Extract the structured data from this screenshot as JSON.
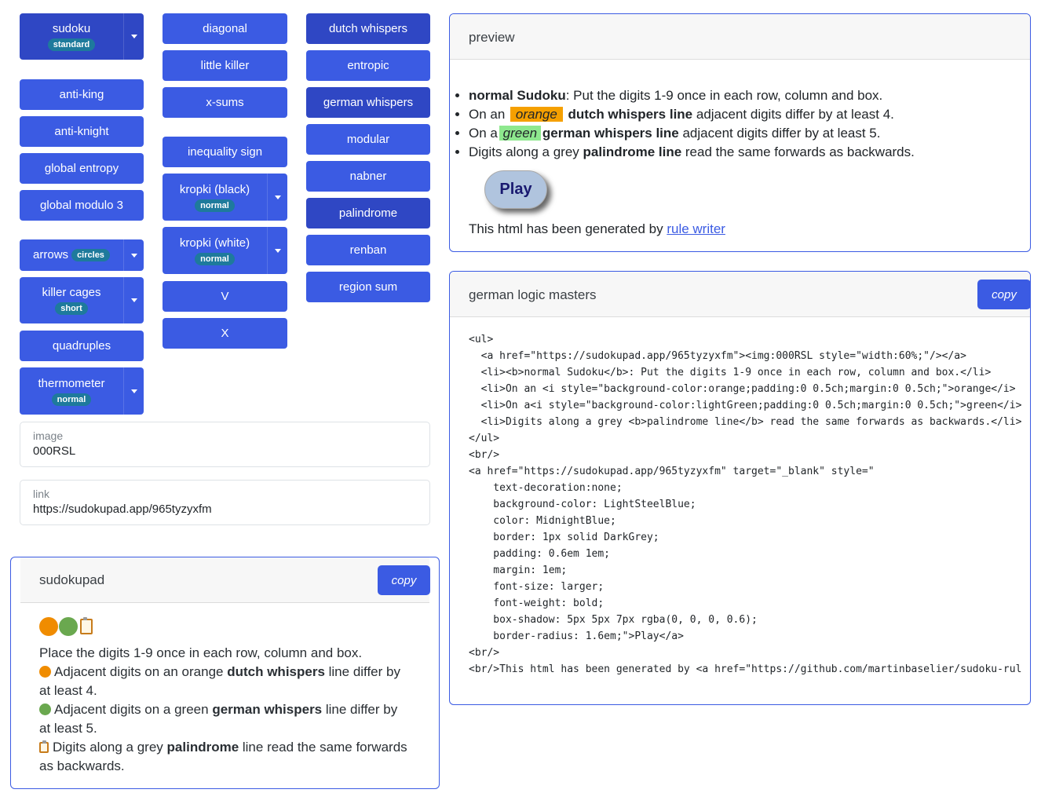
{
  "col1": {
    "sudoku": {
      "label": "sudoku",
      "badge": "standard"
    },
    "anti_king": "anti-king",
    "anti_knight": "anti-knight",
    "global_entropy": "global entropy",
    "global_modulo": "global modulo 3",
    "arrows": {
      "label": "arrows",
      "badge": "circles"
    },
    "killer_cages": {
      "label": "killer cages",
      "badge": "short"
    },
    "quadruples": "quadruples",
    "thermometer": {
      "label": "thermometer",
      "badge": "normal"
    }
  },
  "col2": {
    "diagonal": "diagonal",
    "little_killer": "little killer",
    "x_sums": "x-sums",
    "inequality_sign": "inequality sign",
    "kropki_black": {
      "label": "kropki (black)",
      "badge": "normal"
    },
    "kropki_white": {
      "label": "kropki (white)",
      "badge": "normal"
    },
    "v": "V",
    "x": "X"
  },
  "col3": {
    "dutch_whispers": "dutch whispers",
    "entropic": "entropic",
    "german_whispers": "german whispers",
    "modular": "modular",
    "nabner": "nabner",
    "palindrome": "palindrome",
    "renban": "renban",
    "region_sum": "region sum"
  },
  "fields": {
    "image": {
      "label": "image",
      "value": "000RSL"
    },
    "link": {
      "label": "link",
      "value": "https://sudokupad.app/965tyzyxfm"
    }
  },
  "preview": {
    "title": "preview",
    "rule1_bold": "normal Sudoku",
    "rule1_rest": ": Put the digits 1-9 once in each row, column and box.",
    "rule2_pre": "On an",
    "rule2_hl": "orange",
    "rule2_bold": "dutch whispers line",
    "rule2_rest": " adjacent digits differ by at least 4.",
    "rule3_pre": "On a",
    "rule3_hl": "green",
    "rule3_bold": "german whispers line",
    "rule3_rest": " adjacent digits differ by at least 5.",
    "rule4_pre": "Digits along a grey ",
    "rule4_bold": "palindrome line",
    "rule4_rest": " read the same forwards as backwards.",
    "play": "Play",
    "generated_pre": "This html has been generated by ",
    "generated_link": "rule writer"
  },
  "glm": {
    "title": "german logic masters",
    "copy": "copy",
    "code_lines": [
      "<ul>",
      "  <a href=\"https://sudokupad.app/965tyzyxfm\"><img:000RSL style=\"width:60%;\"/></a>",
      "  <li><b>normal Sudoku</b>: Put the digits 1-9 once in each row, column and box.</li>",
      "  <li>On an <i style=\"background-color:orange;padding:0 0.5ch;margin:0 0.5ch;\">orange</i>",
      "  <li>On a<i style=\"background-color:lightGreen;padding:0 0.5ch;margin:0 0.5ch;\">green</i>",
      "  <li>Digits along a grey <b>palindrome line</b> read the same forwards as backwards.</li>",
      "</ul>",
      "<br/>",
      "<a href=\"https://sudokupad.app/965tyzyxfm\" target=\"_blank\" style=\"",
      "    text-decoration:none;",
      "    background-color: LightSteelBlue;",
      "    color: MidnightBlue;",
      "    border: 1px solid DarkGrey;",
      "    padding: 0.6em 1em;",
      "    margin: 1em;",
      "    font-size: larger;",
      "    font-weight: bold;",
      "    box-shadow: 5px 5px 7px rgba(0, 0, 0, 0.6);",
      "    border-radius: 1.6em;\">Play</a>",
      "<br/>",
      "<br/>This html has been generated by <a href=\"https://github.com/martinbaselier/sudoku-rul"
    ]
  },
  "sudokupad": {
    "title": "sudokupad",
    "copy": "copy",
    "line1": "Place the digits 1-9 once in each row, column and box.",
    "line2_pre": "Adjacent digits on an orange ",
    "line2_bold": "dutch whispers",
    "line2_rest": " line differ by at least 4.",
    "line3_pre": "Adjacent digits on a green ",
    "line3_bold": "german whispers",
    "line3_rest": " line differ by at least 5.",
    "line4_pre": "Digits along a grey ",
    "line4_bold": "palindrome",
    "line4_rest": " line read the same forwards as backwards."
  },
  "colors": {
    "accent": "#3b5be3",
    "accent_dark": "#2f47c4",
    "badge": "#1e7a9c",
    "orange": "#f5a000",
    "green": "#8ee88e"
  }
}
